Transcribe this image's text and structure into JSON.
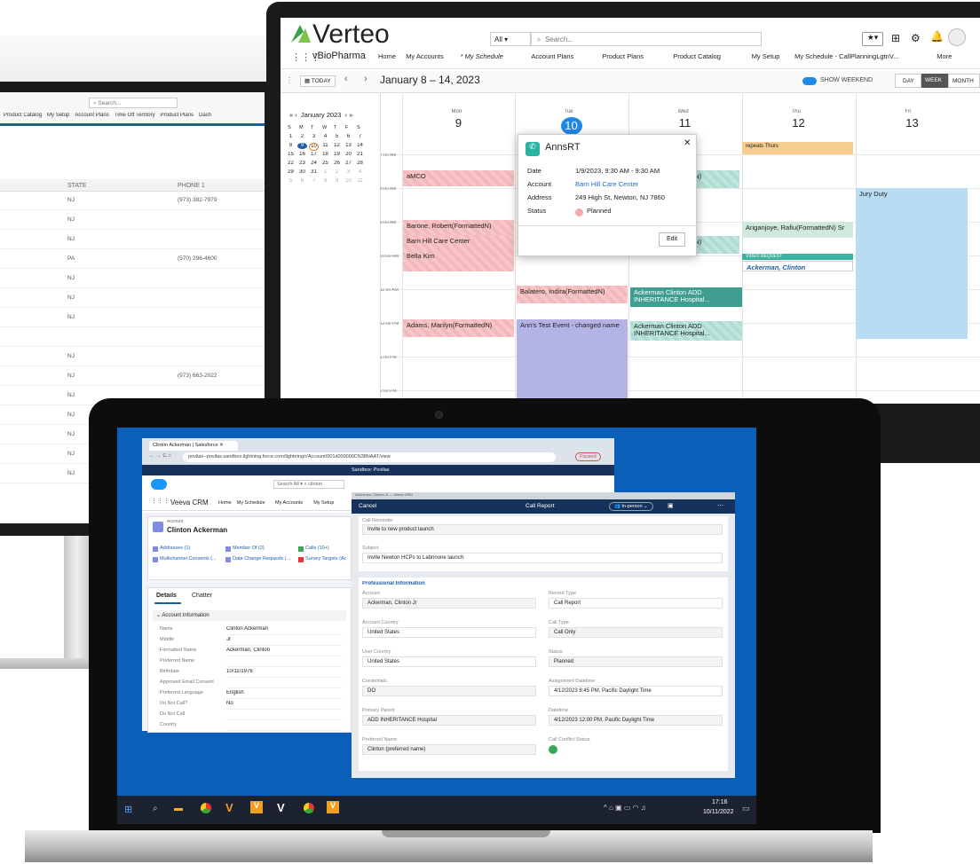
{
  "left_monitor": {
    "search": "Search...",
    "nav": [
      "Product Catalog",
      "My Setup",
      "Account Plans",
      "Time Off Territory",
      "Product Plans",
      "Dash"
    ],
    "cols": [
      "STATE",
      "PHONE 1"
    ],
    "rows": [
      [
        "NJ",
        "(973) 382-7979"
      ],
      [
        "NJ",
        ""
      ],
      [
        "NJ",
        ""
      ],
      [
        "PA",
        "(570) 296-4600"
      ],
      [
        "NJ",
        ""
      ],
      [
        "NJ",
        ""
      ],
      [
        "NJ",
        ""
      ],
      [
        "",
        ""
      ],
      [
        "NJ",
        ""
      ],
      [
        "NJ",
        "(973) 663-2022"
      ],
      [
        "NJ",
        ""
      ],
      [
        "NJ",
        ""
      ],
      [
        "NJ",
        ""
      ],
      [
        "NJ",
        ""
      ],
      [
        "NJ",
        ""
      ]
    ]
  },
  "right_monitor": {
    "logo": "Verteo",
    "brand": "vBioPharma",
    "search_scope": "All",
    "search_ph": "Search...",
    "nav": [
      "Home",
      "My Accounts",
      "* My Schedule",
      "Account Plans",
      "Product Plans",
      "Product Catalog",
      "My Setup",
      "My Schedule - CallPlanningLgtnV...",
      "More"
    ],
    "today": "TODAY",
    "range": "January 8 – 14, 2023",
    "weekend": "SHOW WEEKEND",
    "views": [
      "DAY",
      "WEEK",
      "MONTH"
    ],
    "mini": {
      "month": "January 2023",
      "dow": [
        "S",
        "M",
        "T",
        "W",
        "T",
        "F",
        "S"
      ],
      "weeks": [
        [
          "1",
          "2",
          "3",
          "4",
          "5",
          "6",
          "7"
        ],
        [
          "8",
          "9",
          "10",
          "11",
          "12",
          "13",
          "14"
        ],
        [
          "15",
          "16",
          "17",
          "18",
          "19",
          "20",
          "21"
        ],
        [
          "22",
          "23",
          "24",
          "25",
          "26",
          "27",
          "28"
        ],
        [
          "29",
          "30",
          "31",
          "1",
          "2",
          "3",
          "4"
        ],
        [
          "5",
          "6",
          "7",
          "8",
          "9",
          "10",
          "11"
        ]
      ]
    },
    "days": [
      {
        "d": "Mon",
        "n": "9"
      },
      {
        "d": "Tue",
        "n": "10"
      },
      {
        "d": "Wed",
        "n": "11"
      },
      {
        "d": "Thu",
        "n": "12"
      },
      {
        "d": "Fri",
        "n": "13"
      }
    ],
    "times": [
      "7:00 AM",
      "8:00 AM",
      "9:00 AM",
      "10:00 AM",
      "11:00 AM",
      "12:00 PM",
      "1:00 PM",
      "2:00 PM"
    ],
    "events": {
      "amco": "aMCO",
      "barone": "Barone, Robert(FormattedN)",
      "barn": "Barn Hill Care Center",
      "bella": "Bella Kim",
      "adams": "Adams, Marilyn(FormattedN)",
      "balatero": "Balatero, Indira(FormattedN)",
      "anns": "Ann's Test Event - changed name",
      "wed1": "ttedN)",
      "wed2": "ttedN)",
      "ack1": "Ackerman Clinton ADD INHERITANCE Hospital...",
      "ack2": "Ackerman Clinton ADD INHERITANCE Hospital...",
      "repeats": "repeats Thurs",
      "arig": "Ariganjoye, Rafiu(FormattedN) Sr",
      "vreq": "VIDEO REQUEST",
      "ackc": "Ackerman, Clinton",
      "jury": "Jury Duty"
    },
    "popup": {
      "title": "AnnsRT",
      "rows": [
        [
          "Date",
          "1/9/2023, 9:30 AM - 9:30 AM"
        ],
        [
          "Account",
          "Barn Hill Care Center"
        ],
        [
          "Address",
          "249 High St, Newton, NJ 7860"
        ],
        [
          "Status",
          "Planned"
        ]
      ],
      "edit": "Edit"
    }
  },
  "laptop": {
    "tab": "Clinton Ackerman | Salesforce",
    "url": "povilas--povilas.sandbox.lightning.force.com/lightning/r/Account/001d000000CN38NAAT/view",
    "paused": "Paused",
    "sandbox": "Sandbox: Povilas",
    "sf_search_scope": "Search All",
    "sf_search": "clinton",
    "app": "Veeva CRM",
    "sf_nav": [
      "Home",
      "My Schedule",
      "My Accounts",
      "My Setup"
    ],
    "acct_label": "Account",
    "acct_name": "Clinton Ackerman",
    "related": [
      "Addresses (1)",
      "Member Of (2)",
      "Calls (10+)",
      "Multichannel Consents (...",
      "Data Change Requests (...",
      "Survey Targets (Ac"
    ],
    "tabs": [
      "Details",
      "Chatter"
    ],
    "section": "Account Information",
    "fields": [
      [
        "Name",
        "Clinton Ackerman"
      ],
      [
        "Middle",
        "Jr"
      ],
      [
        "Formatted Name",
        "Ackerman, Clinton"
      ],
      [
        "Preferred Name",
        ""
      ],
      [
        "Birthdate",
        "10/11/1976"
      ],
      [
        "Approved Email Consent",
        ""
      ],
      [
        "Preferred Language",
        "English"
      ],
      [
        "Do Not Call?",
        "No"
      ],
      [
        "Do Not Call",
        ""
      ],
      [
        "Country",
        ""
      ]
    ],
    "cr_title_bar": "Ackerman, Clinton Jr — Veeva CRM",
    "cr_cancel": "Cancel",
    "cr_title": "Call Report",
    "cr_mode": "In-person",
    "cr_reminder_lbl": "Call Reminder",
    "cr_reminder": "Invite to new product launch",
    "cr_subject_lbl": "Subject",
    "cr_subject": "Invite Newton HCPs to Labrinone launch",
    "cr_section": "Professional Information",
    "cr_left": [
      [
        "Account",
        "Ackerman, Clinton Jr"
      ],
      [
        "Account Country",
        "United States"
      ],
      [
        "User Country",
        "United States"
      ],
      [
        "Credentials",
        "DO"
      ],
      [
        "Primary Parent",
        "ADD INHERITANCE Hospital"
      ],
      [
        "Preferred Name",
        "Clinton (preferred name)"
      ]
    ],
    "cr_right": [
      [
        "Record Type",
        "Call Report"
      ],
      [
        "Call Type",
        "Call Only"
      ],
      [
        "Status",
        "Planned"
      ],
      [
        "Assignment Datetime",
        "4/12/2023 8:45 PM, Pacific Daylight Time"
      ],
      [
        "Datetime",
        "4/12/2023 12:00 PM, Pacific Daylight Time"
      ],
      [
        "Call Conflict Status",
        ""
      ]
    ],
    "time": "17:16",
    "date": "10/11/2022"
  }
}
